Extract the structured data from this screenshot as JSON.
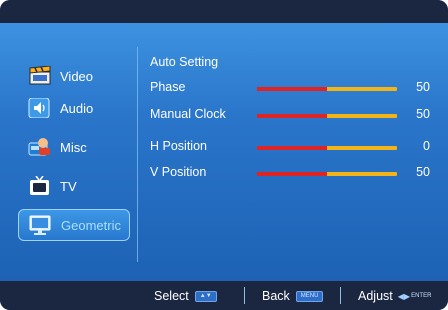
{
  "sidebar": {
    "items": [
      {
        "label": "Video",
        "icon": "clapperboard-icon"
      },
      {
        "label": "Audio",
        "icon": "speaker-icon"
      },
      {
        "label": "Misc",
        "icon": "misc-icon"
      },
      {
        "label": "TV",
        "icon": "tv-icon"
      },
      {
        "label": "Geometric",
        "icon": "monitor-icon",
        "selected": true
      }
    ]
  },
  "panel": {
    "auto_setting": "Auto Setting",
    "rows": [
      {
        "label": "Phase",
        "value": "50",
        "level": 0.5
      },
      {
        "label": "Manual Clock",
        "value": "50",
        "level": 0.5
      },
      {
        "label": "H Position",
        "value": "0",
        "level": 0.5
      },
      {
        "label": "V Position",
        "value": "50",
        "level": 0.5
      }
    ]
  },
  "footer": {
    "select": "Select",
    "back": "Back",
    "back_key": "MENU",
    "adjust": "Adjust",
    "adjust_key": "ENTER"
  },
  "colors": {
    "bar_left": "#e02424",
    "bar_right": "#f2b416",
    "selected_text": "#a8e0ff"
  }
}
